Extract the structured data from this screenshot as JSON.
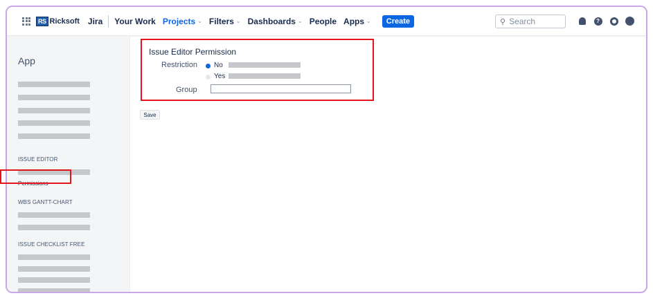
{
  "topnav": {
    "logo_badge": "RS",
    "logo_text": "Ricksoft",
    "brand": "Jira",
    "items": [
      {
        "label": "Your Work",
        "dropdown": false,
        "active": false
      },
      {
        "label": "Projects",
        "dropdown": true,
        "active": true
      },
      {
        "label": "Filters",
        "dropdown": true,
        "active": false
      },
      {
        "label": "Dashboards",
        "dropdown": true,
        "active": false
      },
      {
        "label": "People",
        "dropdown": false,
        "active": false
      },
      {
        "label": "Apps",
        "dropdown": true,
        "active": false
      }
    ],
    "create_label": "Create",
    "search_placeholder": "Search",
    "icons": [
      "notifications-icon",
      "help-icon",
      "settings-icon",
      "avatar"
    ]
  },
  "sidebar": {
    "title": "App",
    "sections": [
      {
        "label": "ISSUE EDITOR"
      },
      {
        "label": "WBS GANTT-CHART"
      },
      {
        "label": "ISSUE CHECKLIST FREE"
      }
    ],
    "selected_item": "Permissions"
  },
  "form": {
    "title": "Issue Editor Permission",
    "restriction_label": "Restriction",
    "options": [
      {
        "label": "No",
        "selected": true
      },
      {
        "label": "Yes",
        "selected": false
      }
    ],
    "group_label": "Group",
    "group_value": ""
  },
  "save_label": "Save",
  "colors": {
    "accent": "#0c66e4",
    "highlight": "#e3121b",
    "frame": "#c9a6ea"
  }
}
